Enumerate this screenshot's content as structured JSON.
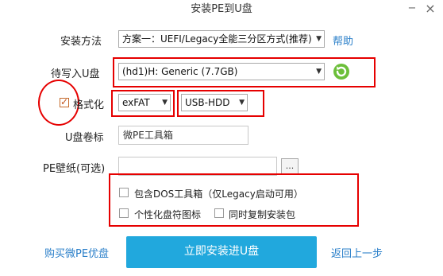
{
  "window": {
    "title": "安装PE到U盘",
    "minimize_glyph": "−",
    "close_glyph": "×"
  },
  "install_method": {
    "label": "安装方法",
    "value": "方案一：UEFI/Legacy全能三分区方式(推荐)",
    "help_link": "帮助"
  },
  "target_disk": {
    "label": "待写入U盘",
    "value": "(hd1)H: Generic  (7.7GB)",
    "refresh_icon": "refresh-icon"
  },
  "format": {
    "label": "格式化",
    "checked": true,
    "filesystem": "exFAT",
    "mode": "USB-HDD"
  },
  "volume_label": {
    "label": "U盘卷标",
    "value": "微PE工具箱"
  },
  "wallpaper": {
    "label": "PE壁纸(可选)",
    "value": "",
    "browse_label": "..."
  },
  "options": [
    {
      "label": "包含DOS工具箱（仅Legacy启动可用）",
      "checked": false
    },
    {
      "label": "个性化盘符图标",
      "checked": false
    },
    {
      "label": "同时复制安装包",
      "checked": false
    }
  ],
  "footer": {
    "buy_link": "购买微PE优盘",
    "install_button": "立即安装进U盘",
    "back_link": "返回上一步"
  },
  "colors": {
    "annotation_red": "#e60000",
    "primary_blue": "#21a8dd",
    "link_blue": "#2a7fc9",
    "refresh_green": "#5aa82a"
  }
}
